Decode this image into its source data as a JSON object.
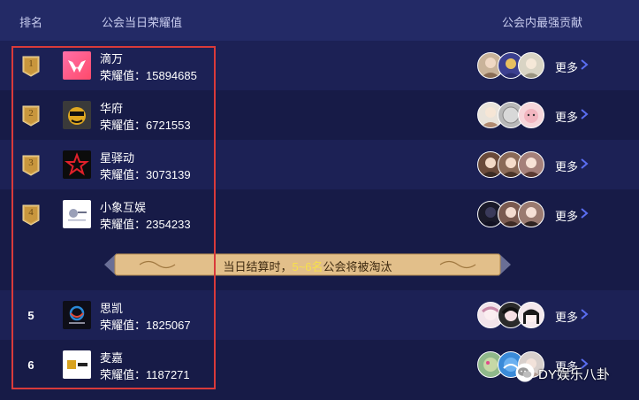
{
  "header": {
    "rank": "排名",
    "guild_honor": "公会当日荣耀值",
    "top_contributors": "公会内最强贡献"
  },
  "rows": [
    {
      "rank": "1",
      "name": "滴万",
      "score": "荣耀值：15894685",
      "more": "更多"
    },
    {
      "rank": "2",
      "name": "华府",
      "score": "荣耀值：6721553",
      "more": "更多"
    },
    {
      "rank": "3",
      "name": "星驿动",
      "score": "荣耀值：3073139",
      "more": "更多"
    },
    {
      "rank": "4",
      "name": "小象互娱",
      "score": "荣耀值：2354233",
      "more": "更多"
    },
    {
      "rank": "5",
      "name": "思凯",
      "score": "荣耀值：1825067",
      "more": "更多"
    },
    {
      "rank": "6",
      "name": "麦嘉",
      "score": "荣耀值：1187271",
      "more": "更多"
    }
  ],
  "banner": {
    "prefix": "当日结算时，",
    "highlight": "5~6名",
    "suffix": "公会将被淘汰"
  },
  "watermark": {
    "text": "DY娱乐八卦"
  },
  "colors": {
    "background": "#171b47",
    "header": "#232a66",
    "row_alt": "#1c2155",
    "highlight_box": "#d93a3a",
    "banner": "#e2bf8a",
    "banner_highlight": "#f7e04a",
    "medal": "#d9ae5c"
  }
}
